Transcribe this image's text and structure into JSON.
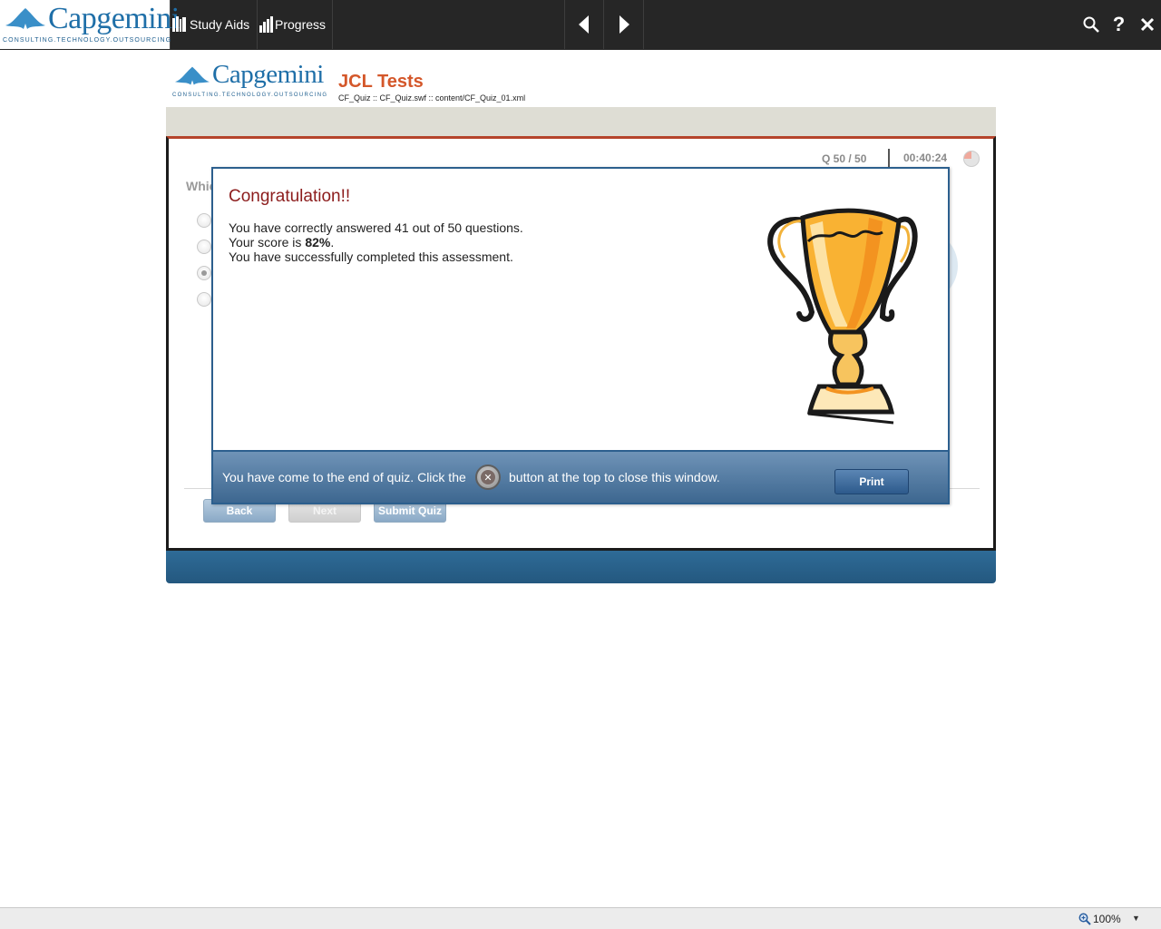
{
  "toolbar": {
    "logo_word": "Capgemini",
    "logo_tagline": "CONSULTING.TECHNOLOGY.OUTSOURCING",
    "study_aids_label": "Study Aids",
    "progress_label": "Progress",
    "prev_icon": "arrow-left-icon",
    "next_icon": "arrow-right-icon",
    "search_icon": "search-icon",
    "help_label": "?",
    "close_icon": "close-icon"
  },
  "course": {
    "logo_word": "Capgemini",
    "logo_tagline": "CONSULTING.TECHNOLOGY.OUTSOURCING",
    "title": "JCL Tests",
    "path": "CF_Quiz :: CF_Quiz.swf :: content/CF_Quiz_01.xml"
  },
  "quiz": {
    "counter": "Q 50 / 50",
    "timer": "00:40:24",
    "question_partial": "Whic",
    "options_count": 4,
    "selected_option": 3,
    "back_label": "Back",
    "next_label": "Next",
    "submit_label": "Submit Quiz"
  },
  "dialog": {
    "title": "Congratulation!!",
    "line1": "You have correctly answered 41 out of 50 questions.",
    "line2_prefix": "Your score is ",
    "score": "82%",
    "line2_suffix": ".",
    "line3": "You have successfully completed this assessment.",
    "footer_before": "You have come to the end of quiz. Click the",
    "footer_after": "button at the top to close this window.",
    "print_label": "Print"
  },
  "status": {
    "zoom": "100%"
  },
  "colors": {
    "toolbar_bg": "#262626",
    "title_orange": "#d4572a",
    "congrats_red": "#8c1c1c",
    "dialog_border": "#2c5f8e"
  }
}
